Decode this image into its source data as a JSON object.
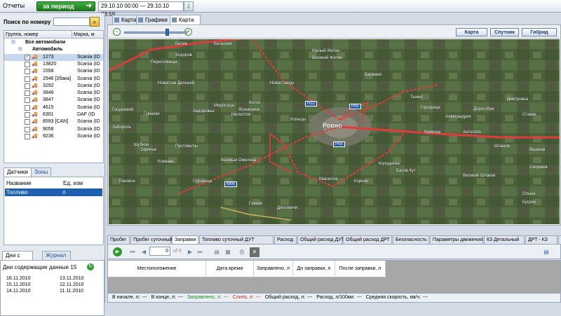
{
  "topbar": {
    "reports_label": "Отчеты",
    "period_button": "за период",
    "date_range": "29.10.10 00:00 — 29.10.10 23:59"
  },
  "left": {
    "search_label": "Поиск по номеру",
    "tree_headers": [
      "Группа, номер",
      "Марка, м"
    ],
    "tree_items": [
      {
        "label": "Все автомобили",
        "level": 0
      },
      {
        "label": "Автомобиль",
        "level": 1
      },
      {
        "number": "1273",
        "make": "Scania (ID",
        "checked": true
      },
      {
        "number": "13820",
        "make": "Scania (ID"
      },
      {
        "number": "1558",
        "make": "Scania (ID"
      },
      {
        "number": "2946 [2бака]",
        "make": "Scania (ID"
      },
      {
        "number": "3292",
        "make": "Scania (ID"
      },
      {
        "number": "3846",
        "make": "Scania (ID"
      },
      {
        "number": "3847",
        "make": "Scania (ID"
      },
      {
        "number": "4615",
        "make": "Scania (ID"
      },
      {
        "number": "6301",
        "make": "DAF (ID"
      },
      {
        "number": "8593 [CAN]",
        "make": "Scania (ID"
      },
      {
        "number": "9058",
        "make": "Scania (ID"
      },
      {
        "number": "9236",
        "make": "Scania (ID"
      }
    ],
    "sensor_tabs": [
      "Датчики",
      "Зоны"
    ],
    "sensor_headers": [
      "Название",
      "Ед. изм"
    ],
    "sensor_rows": [
      {
        "name": "Топливо",
        "unit": "л"
      }
    ],
    "day_tabs": [
      "Дни с данными",
      "Журнал событий"
    ],
    "days_label": "Дни содержащие данные",
    "days_count": "15",
    "days": [
      [
        "16.11.2010",
        "13.11.2010"
      ],
      [
        "15.11.2010",
        "12.11.2010"
      ],
      [
        "14.11.2010",
        "11.11.2010"
      ]
    ]
  },
  "map_tabs": [
    "Карта",
    "Графики",
    "Карта Google"
  ],
  "map_types": [
    "Карта",
    "Спутник",
    "Гибрид"
  ],
  "map": {
    "city": "Ровно",
    "places": [
      "Белев",
      "Бельские",
      "Ходоров",
      "Малый Житин",
      "Великий Житин",
      "Великая Омеляна",
      "Грушвица",
      "Квасилов",
      "Колоденка",
      "Басов Кут",
      "Гощанский",
      "Гумнеки",
      "Пересопница",
      "Забороль",
      "Бармаки",
      "Корнин",
      "Глинки",
      "Дятковичи",
      "Новостав Дальний",
      "Мирогоща",
      "Котов",
      "Угольцы",
      "Шубков",
      "Дмитровка",
      "Александрия",
      "Городище",
      "Дорогобуж",
      "Кривица",
      "Антополь",
      "Ставки",
      "Вышков",
      "Шпанов",
      "Великий Шпаков",
      "Милостов",
      "Ясининичи",
      "Тынне",
      "Бугрин",
      "Задорожье",
      "Новоставцы",
      "Раковое",
      "Заречье",
      "Клевань",
      "Пустомыты",
      "Сморжев",
      "Олыка"
    ],
    "roads": [
      "H22",
      "P05",
      "P05",
      "M06",
      "H22"
    ]
  },
  "report_tabs": [
    "Пробег",
    "Пробег суточный",
    "Заправки",
    "Топливо суточный ДУТ",
    "Расход",
    "Общий расход ДУТ",
    "Общий расход ДРТ",
    "Безопасность",
    "Параметры движения",
    "КЗ Детальный",
    "ДРТ - КЗ",
    "ДУТ"
  ],
  "report_toolbar": {
    "page_value": "0",
    "page_of": "of 0"
  },
  "report_columns": [
    "Местоположение",
    "Дата время",
    "Заправлено, л",
    "До заправки, л",
    "После заправки, л"
  ],
  "status_bar": [
    {
      "label": "В начале, л:",
      "value": "---"
    },
    {
      "label": "В конце, л:",
      "value": "---"
    },
    {
      "label": "Заправлено, л:",
      "value": "---",
      "color": "#1e8a1e"
    },
    {
      "label": "Слито, л:",
      "value": "---",
      "color": "#c02020"
    },
    {
      "label": "Общий расход, л:",
      "value": "---"
    },
    {
      "label": "Расход, л/100км:",
      "value": "---"
    },
    {
      "label": "Средняя скорость, км/ч:",
      "value": "---"
    }
  ],
  "colors": {
    "accent": "#1f5fb0",
    "go_button": "#2f9a2f",
    "route": "#e53a3a"
  }
}
